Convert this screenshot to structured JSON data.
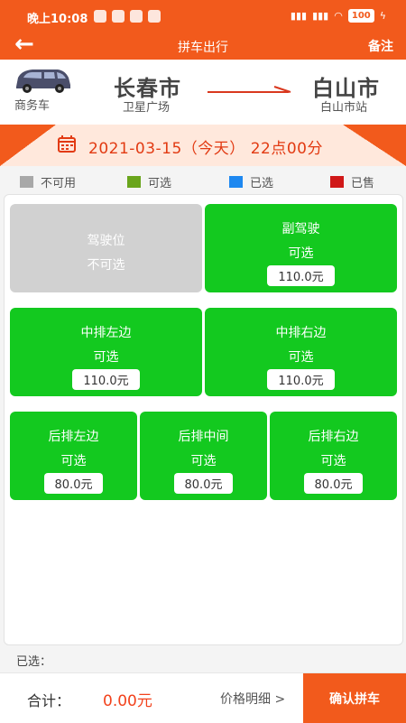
{
  "status_bar": {
    "time": "晚上10:08",
    "battery": "100"
  },
  "header": {
    "title": "拼车出行",
    "note_label": "备注"
  },
  "route": {
    "vehicle_type": "商务车",
    "from_city": "长春市",
    "from_station": "卫星广场",
    "to_city": "白山市",
    "to_station": "白山市站"
  },
  "trip": {
    "date_text": "2021-03-15（今天）  22点00分"
  },
  "legend": [
    {
      "label": "不可用",
      "color": "#a8a8a8"
    },
    {
      "label": "可选",
      "color": "#6aa51c"
    },
    {
      "label": "已选",
      "color": "#1e88f0"
    },
    {
      "label": "已售",
      "color": "#d01818"
    }
  ],
  "seats": {
    "driver": {
      "name": "驾驶位",
      "status": "不可选"
    },
    "copilot": {
      "name": "副驾驶",
      "status": "可选",
      "price": "110.0元"
    },
    "mid_left": {
      "name": "中排左边",
      "status": "可选",
      "price": "110.0元"
    },
    "mid_right": {
      "name": "中排右边",
      "status": "可选",
      "price": "110.0元"
    },
    "back_left": {
      "name": "后排左边",
      "status": "可选",
      "price": "80.0元"
    },
    "back_middle": {
      "name": "后排中间",
      "status": "可选",
      "price": "80.0元"
    },
    "back_right": {
      "name": "后排右边",
      "status": "可选",
      "price": "80.0元"
    }
  },
  "selected_label": "已选：",
  "footer": {
    "total_label": "合计：",
    "total_value": "0.00元",
    "price_detail": "价格明细 >",
    "confirm_label": "确认拼车"
  },
  "colors": {
    "brand": "#f25a1c",
    "seat_available": "#13c91f",
    "seat_unavailable": "#d1d1d1"
  }
}
